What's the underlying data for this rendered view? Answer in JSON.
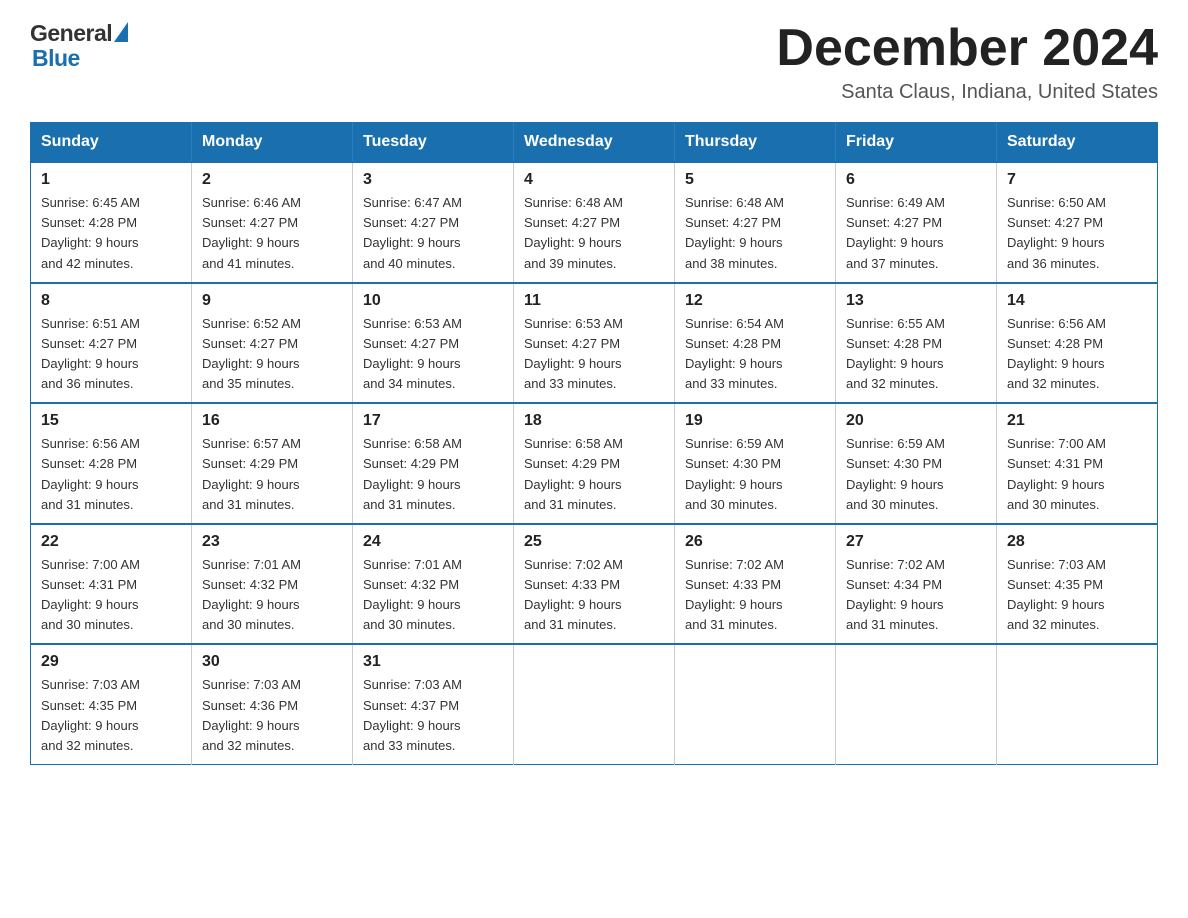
{
  "header": {
    "month_title": "December 2024",
    "location": "Santa Claus, Indiana, United States",
    "logo_general": "General",
    "logo_blue": "Blue"
  },
  "calendar": {
    "days_of_week": [
      "Sunday",
      "Monday",
      "Tuesday",
      "Wednesday",
      "Thursday",
      "Friday",
      "Saturday"
    ],
    "weeks": [
      [
        {
          "day": "1",
          "sunrise": "6:45 AM",
          "sunset": "4:28 PM",
          "daylight": "9 hours and 42 minutes."
        },
        {
          "day": "2",
          "sunrise": "6:46 AM",
          "sunset": "4:27 PM",
          "daylight": "9 hours and 41 minutes."
        },
        {
          "day": "3",
          "sunrise": "6:47 AM",
          "sunset": "4:27 PM",
          "daylight": "9 hours and 40 minutes."
        },
        {
          "day": "4",
          "sunrise": "6:48 AM",
          "sunset": "4:27 PM",
          "daylight": "9 hours and 39 minutes."
        },
        {
          "day": "5",
          "sunrise": "6:48 AM",
          "sunset": "4:27 PM",
          "daylight": "9 hours and 38 minutes."
        },
        {
          "day": "6",
          "sunrise": "6:49 AM",
          "sunset": "4:27 PM",
          "daylight": "9 hours and 37 minutes."
        },
        {
          "day": "7",
          "sunrise": "6:50 AM",
          "sunset": "4:27 PM",
          "daylight": "9 hours and 36 minutes."
        }
      ],
      [
        {
          "day": "8",
          "sunrise": "6:51 AM",
          "sunset": "4:27 PM",
          "daylight": "9 hours and 36 minutes."
        },
        {
          "day": "9",
          "sunrise": "6:52 AM",
          "sunset": "4:27 PM",
          "daylight": "9 hours and 35 minutes."
        },
        {
          "day": "10",
          "sunrise": "6:53 AM",
          "sunset": "4:27 PM",
          "daylight": "9 hours and 34 minutes."
        },
        {
          "day": "11",
          "sunrise": "6:53 AM",
          "sunset": "4:27 PM",
          "daylight": "9 hours and 33 minutes."
        },
        {
          "day": "12",
          "sunrise": "6:54 AM",
          "sunset": "4:28 PM",
          "daylight": "9 hours and 33 minutes."
        },
        {
          "day": "13",
          "sunrise": "6:55 AM",
          "sunset": "4:28 PM",
          "daylight": "9 hours and 32 minutes."
        },
        {
          "day": "14",
          "sunrise": "6:56 AM",
          "sunset": "4:28 PM",
          "daylight": "9 hours and 32 minutes."
        }
      ],
      [
        {
          "day": "15",
          "sunrise": "6:56 AM",
          "sunset": "4:28 PM",
          "daylight": "9 hours and 31 minutes."
        },
        {
          "day": "16",
          "sunrise": "6:57 AM",
          "sunset": "4:29 PM",
          "daylight": "9 hours and 31 minutes."
        },
        {
          "day": "17",
          "sunrise": "6:58 AM",
          "sunset": "4:29 PM",
          "daylight": "9 hours and 31 minutes."
        },
        {
          "day": "18",
          "sunrise": "6:58 AM",
          "sunset": "4:29 PM",
          "daylight": "9 hours and 31 minutes."
        },
        {
          "day": "19",
          "sunrise": "6:59 AM",
          "sunset": "4:30 PM",
          "daylight": "9 hours and 30 minutes."
        },
        {
          "day": "20",
          "sunrise": "6:59 AM",
          "sunset": "4:30 PM",
          "daylight": "9 hours and 30 minutes."
        },
        {
          "day": "21",
          "sunrise": "7:00 AM",
          "sunset": "4:31 PM",
          "daylight": "9 hours and 30 minutes."
        }
      ],
      [
        {
          "day": "22",
          "sunrise": "7:00 AM",
          "sunset": "4:31 PM",
          "daylight": "9 hours and 30 minutes."
        },
        {
          "day": "23",
          "sunrise": "7:01 AM",
          "sunset": "4:32 PM",
          "daylight": "9 hours and 30 minutes."
        },
        {
          "day": "24",
          "sunrise": "7:01 AM",
          "sunset": "4:32 PM",
          "daylight": "9 hours and 30 minutes."
        },
        {
          "day": "25",
          "sunrise": "7:02 AM",
          "sunset": "4:33 PM",
          "daylight": "9 hours and 31 minutes."
        },
        {
          "day": "26",
          "sunrise": "7:02 AM",
          "sunset": "4:33 PM",
          "daylight": "9 hours and 31 minutes."
        },
        {
          "day": "27",
          "sunrise": "7:02 AM",
          "sunset": "4:34 PM",
          "daylight": "9 hours and 31 minutes."
        },
        {
          "day": "28",
          "sunrise": "7:03 AM",
          "sunset": "4:35 PM",
          "daylight": "9 hours and 32 minutes."
        }
      ],
      [
        {
          "day": "29",
          "sunrise": "7:03 AM",
          "sunset": "4:35 PM",
          "daylight": "9 hours and 32 minutes."
        },
        {
          "day": "30",
          "sunrise": "7:03 AM",
          "sunset": "4:36 PM",
          "daylight": "9 hours and 32 minutes."
        },
        {
          "day": "31",
          "sunrise": "7:03 AM",
          "sunset": "4:37 PM",
          "daylight": "9 hours and 33 minutes."
        },
        null,
        null,
        null,
        null
      ]
    ]
  }
}
